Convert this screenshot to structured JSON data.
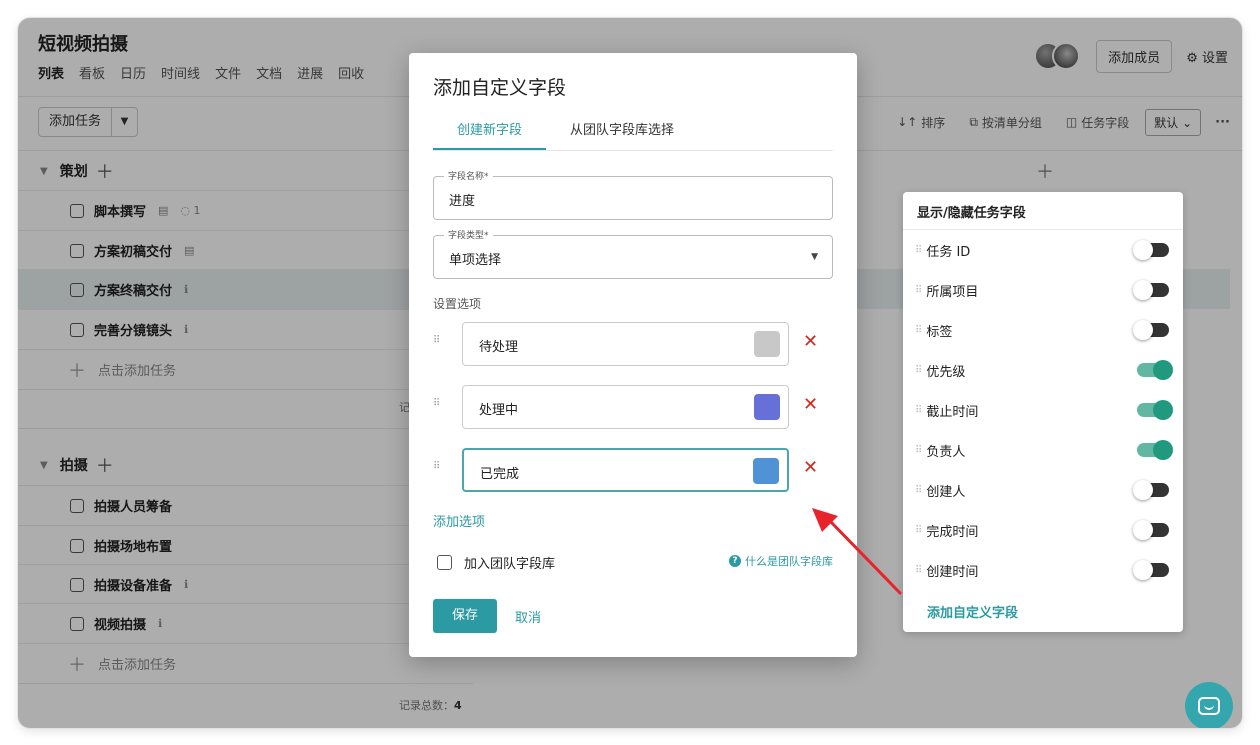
{
  "project": {
    "title": "短视频拍摄",
    "nav_tabs": [
      "列表",
      "看板",
      "日历",
      "时间线",
      "文件",
      "文档",
      "进展",
      "回收"
    ],
    "add_member_label": "添加成员",
    "settings_label": "设置"
  },
  "toolbar": {
    "add_task_label": "添加任务",
    "sort_label": "排序",
    "group_label": "按清单分组",
    "fields_label": "任务字段",
    "view_select": "默认"
  },
  "groups": [
    {
      "name": "策划",
      "tasks": [
        {
          "title": "脚本撰写",
          "meta": "1"
        },
        {
          "title": "方案初稿交付",
          "meta": ""
        },
        {
          "title": "方案终稿交付",
          "meta": ""
        },
        {
          "title": "完善分镜镜头",
          "meta": ""
        }
      ],
      "add_label": "点击添加任务",
      "records_label": "记"
    },
    {
      "name": "拍摄",
      "tasks": [
        {
          "title": "拍摄人员筹备",
          "meta": ""
        },
        {
          "title": "拍摄场地布置",
          "meta": ""
        },
        {
          "title": "拍摄设备准备",
          "meta": ""
        },
        {
          "title": "视频拍摄",
          "meta": ""
        }
      ],
      "add_label": "点击添加任务",
      "records_label": "记录总数：",
      "records_count": "4"
    }
  ],
  "field_panel": {
    "title": "显示/隐藏任务字段",
    "fields": [
      {
        "label": "任务 ID",
        "on": false
      },
      {
        "label": "所属项目",
        "on": false
      },
      {
        "label": "标签",
        "on": false
      },
      {
        "label": "优先级",
        "on": true
      },
      {
        "label": "截止时间",
        "on": true
      },
      {
        "label": "负责人",
        "on": true
      },
      {
        "label": "创建人",
        "on": false
      },
      {
        "label": "完成时间",
        "on": false
      },
      {
        "label": "创建时间",
        "on": false
      }
    ],
    "add_custom_label": "添加自定义字段"
  },
  "modal": {
    "title": "添加自定义字段",
    "tabs": [
      "创建新字段",
      "从团队字段库选择"
    ],
    "field_name_label": "字段名称*",
    "field_name_value": "进度",
    "field_type_label": "字段类型*",
    "field_type_value": "单项选择",
    "options_label": "设置选项",
    "options": [
      {
        "text": "待处理",
        "color": "#c8c8c8"
      },
      {
        "text": "处理中",
        "color": "#6670d6"
      },
      {
        "text": "已完成",
        "color": "#4f93d6"
      }
    ],
    "add_option_label": "添加选项",
    "team_lib_checkbox_label": "加入团队字段库",
    "help_link": "什么是团队字段库",
    "save_label": "保存",
    "cancel_label": "取消"
  },
  "colors": {
    "accent": "#2b9aa3",
    "toggle_on": "#20997e",
    "delete": "#d7261e",
    "annotation_arrow": "#e8242a"
  }
}
